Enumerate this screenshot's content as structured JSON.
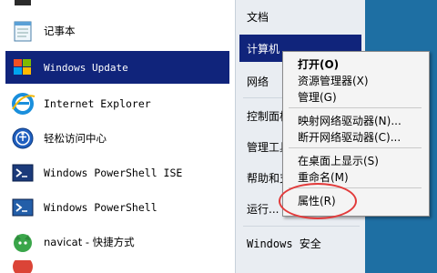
{
  "programs": [
    {
      "label": "记事本",
      "icon": "notepad-icon"
    },
    {
      "label": "Windows Update",
      "icon": "windows-update-icon"
    },
    {
      "label": "Internet Explorer",
      "icon": "ie-icon"
    },
    {
      "label": "轻松访问中心",
      "icon": "ease-of-access-icon"
    },
    {
      "label": "Windows PowerShell ISE",
      "icon": "powershell-ise-icon"
    },
    {
      "label": "Windows PowerShell",
      "icon": "powershell-icon"
    },
    {
      "label": "navicat - 快捷方式",
      "icon": "navicat-icon"
    }
  ],
  "right_links": [
    {
      "label": "文档"
    },
    {
      "label": "计算机"
    },
    {
      "label": "网络"
    },
    {
      "label": "控制面板"
    },
    {
      "label": "管理工具"
    },
    {
      "label": "帮助和支持"
    },
    {
      "label": "运行..."
    },
    {
      "label": "Windows 安全"
    }
  ],
  "context_menu": [
    {
      "label": "打开(O)"
    },
    {
      "label": "资源管理器(X)"
    },
    {
      "label": "管理(G)"
    },
    {
      "label": "映射网络驱动器(N)..."
    },
    {
      "label": "断开网络驱动器(C)..."
    },
    {
      "label": "在桌面上显示(S)"
    },
    {
      "label": "重命名(M)"
    },
    {
      "label": "属性(R)"
    }
  ]
}
